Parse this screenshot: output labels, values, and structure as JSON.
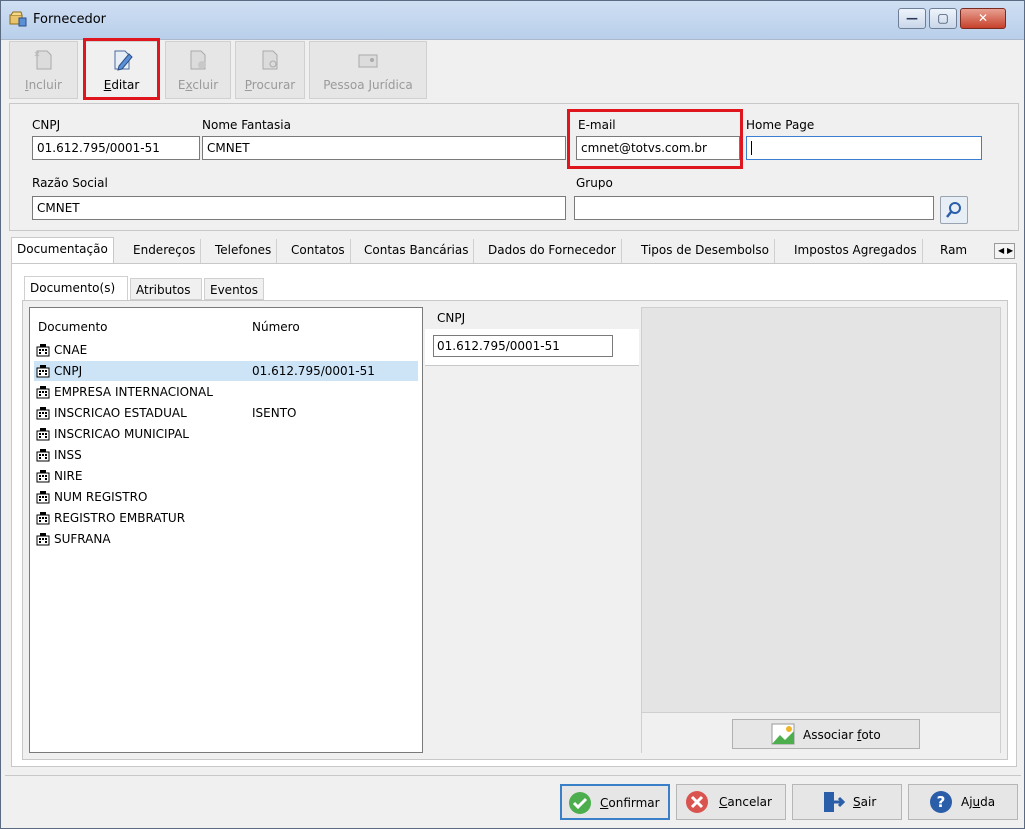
{
  "window": {
    "title": "Fornecedor"
  },
  "toolbar": {
    "buttons": [
      {
        "label": "Incluir",
        "enabled": false
      },
      {
        "label": "Editar",
        "enabled": true
      },
      {
        "label": "Excluir",
        "enabled": false
      },
      {
        "label": "Procurar",
        "enabled": false
      },
      {
        "label": "Pessoa Jurídica",
        "enabled": false
      }
    ]
  },
  "form": {
    "cnpj_label": "CNPJ",
    "cnpj_value": "01.612.795/0001-51",
    "nome_fantasia_label": "Nome Fantasia",
    "nome_fantasia_value": "CMNET",
    "email_label": "E-mail",
    "email_value": "cmnet@totvs.com.br",
    "home_page_label": "Home Page",
    "home_page_value": "",
    "razao_social_label": "Razão Social",
    "razao_social_value": "CMNET",
    "grupo_label": "Grupo",
    "grupo_value": ""
  },
  "tabs": [
    "Documentação",
    "Endereços",
    "Telefones",
    "Contatos",
    "Contas Bancárias",
    "Dados do Fornecedor",
    "Tipos de Desembolso",
    "Impostos Agregados",
    "Ram"
  ],
  "inner_tabs": [
    "Documento(s)",
    "Atributos",
    "Eventos"
  ],
  "documents": {
    "col_documento": "Documento",
    "col_numero": "Número",
    "rows": [
      {
        "name": "CNAE",
        "number": ""
      },
      {
        "name": "CNPJ",
        "number": "01.612.795/0001-51"
      },
      {
        "name": "EMPRESA INTERNACIONAL",
        "number": ""
      },
      {
        "name": "INSCRICAO ESTADUAL",
        "number": "ISENTO"
      },
      {
        "name": "INSCRICAO MUNICIPAL",
        "number": ""
      },
      {
        "name": "INSS",
        "number": ""
      },
      {
        "name": "NIRE",
        "number": ""
      },
      {
        "name": "NUM REGISTRO",
        "number": ""
      },
      {
        "name": "REGISTRO EMBRATUR",
        "number": ""
      },
      {
        "name": "SUFRANA",
        "number": ""
      }
    ]
  },
  "detail": {
    "header": "CNPJ",
    "value": "01.612.795/0001-51"
  },
  "photo": {
    "button_label": "Associar foto"
  },
  "footer": {
    "confirm": "Confirmar",
    "cancel": "Cancelar",
    "exit": "Sair",
    "help": "Ajuda"
  }
}
